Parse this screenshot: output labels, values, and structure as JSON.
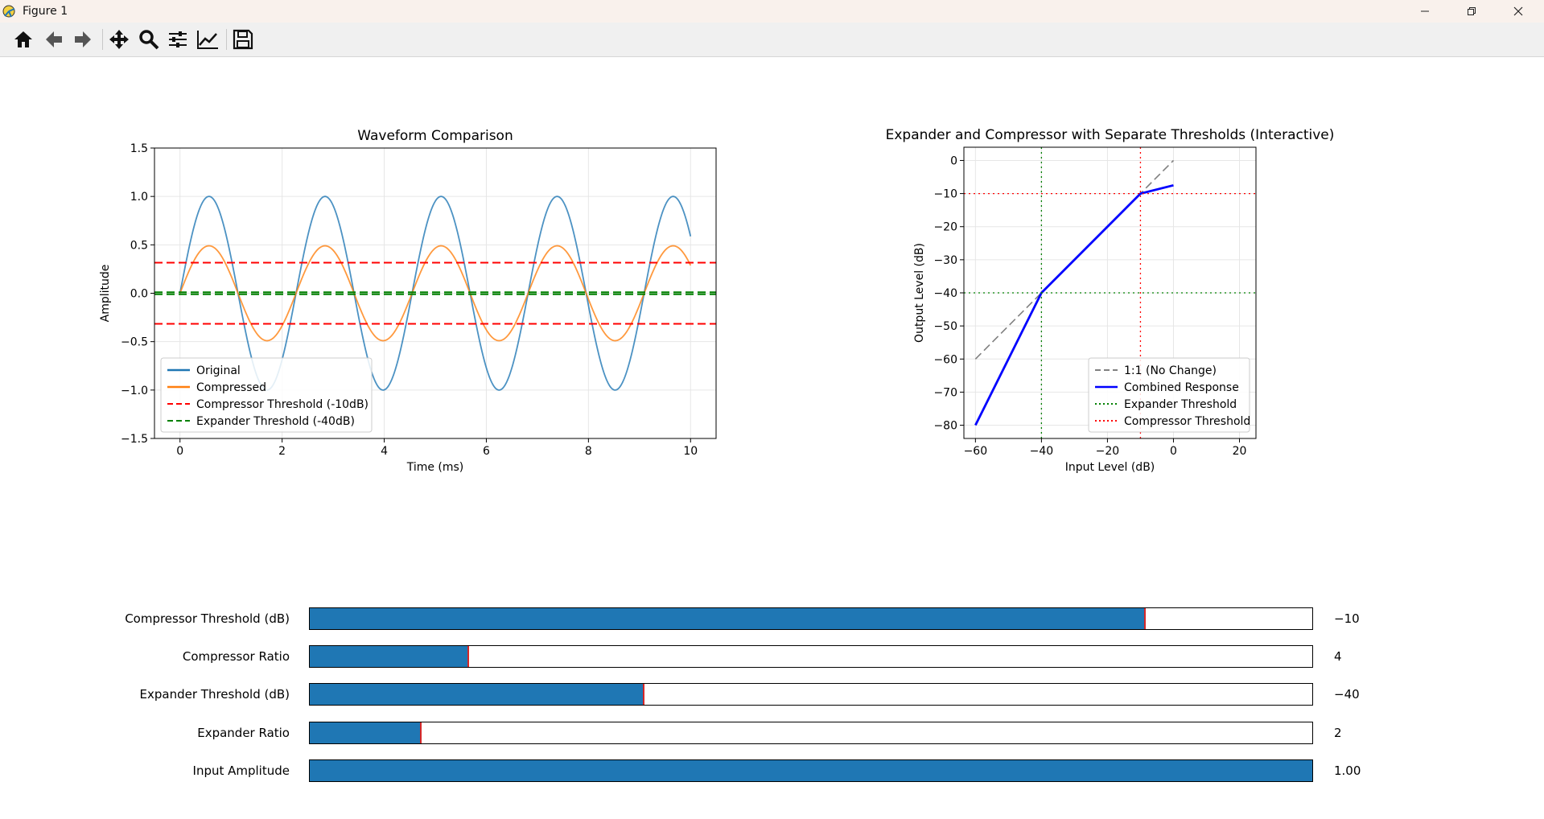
{
  "window": {
    "title": "Figure 1"
  },
  "toolbar": {
    "buttons": [
      {
        "name": "home-button",
        "icon": "home-icon"
      },
      {
        "name": "back-button",
        "icon": "arrow-left-icon"
      },
      {
        "name": "forward-button",
        "icon": "arrow-right-icon"
      },
      {
        "name": "pan-button",
        "icon": "move-icon"
      },
      {
        "name": "zoom-button",
        "icon": "magnifier-icon"
      },
      {
        "name": "configure-subplots-button",
        "icon": "sliders-icon"
      },
      {
        "name": "edit-axes-button",
        "icon": "line-chart-icon"
      },
      {
        "name": "save-button",
        "icon": "floppy-disk-icon"
      }
    ]
  },
  "chart_data": [
    {
      "type": "line",
      "title": "Waveform Comparison",
      "xlabel": "Time (ms)",
      "ylabel": "Amplitude",
      "xlim": [
        -0.5,
        10.5
      ],
      "ylim": [
        -1.5,
        1.5
      ],
      "xticks": [
        0,
        2,
        4,
        6,
        8,
        10
      ],
      "yticks": [
        -1.5,
        -1.0,
        -0.5,
        0.0,
        0.5,
        1.0,
        1.5
      ],
      "xtick_labels": [
        "0",
        "2",
        "4",
        "6",
        "8",
        "10"
      ],
      "ytick_labels": [
        "−1.5",
        "−1.0",
        "−0.5",
        "0.0",
        "0.5",
        "1.0",
        "1.5"
      ],
      "grid": true,
      "legend": "lower-left",
      "series": [
        {
          "name": "Original",
          "color": "#1f77b4",
          "function": "sine",
          "amplitude": 1.0,
          "frequency_khz": 0.44,
          "x_range": [
            0,
            10
          ]
        },
        {
          "name": "Compressed",
          "color": "#ff7f0e",
          "function": "sine",
          "amplitude": 0.49,
          "frequency_khz": 0.44,
          "x_range": [
            0,
            10
          ]
        },
        {
          "name": "Compressor Threshold (-10dB)",
          "color": "#ff0000",
          "style": "dashed",
          "hlines": [
            0.316,
            -0.316
          ]
        },
        {
          "name": "Expander Threshold (-40dB)",
          "color": "#008000",
          "style": "dashed",
          "hlines": [
            0.01,
            -0.01
          ]
        }
      ]
    },
    {
      "type": "line",
      "title": "Expander and Compressor with Separate Thresholds (Interactive)",
      "xlabel": "Input Level (dB)",
      "ylabel": "Output Level (dB)",
      "xlim": [
        -63.5,
        25
      ],
      "ylim": [
        -84,
        4
      ],
      "xticks": [
        -60,
        -40,
        -20,
        0,
        20
      ],
      "yticks": [
        -80,
        -70,
        -60,
        -50,
        -40,
        -30,
        -20,
        -10,
        0
      ],
      "xtick_labels": [
        "−60",
        "−40",
        "−20",
        "0",
        "20"
      ],
      "ytick_labels": [
        "−80",
        "−70",
        "−60",
        "−50",
        "−40",
        "−30",
        "−20",
        "−10",
        "0"
      ],
      "grid": true,
      "legend": "lower-right",
      "series": [
        {
          "name": "1:1 (No Change)",
          "color": "#808080",
          "style": "dashed",
          "x": [
            -60,
            0
          ],
          "y": [
            -60,
            0
          ]
        },
        {
          "name": "Combined Response",
          "color": "#0000ff",
          "style": "solid",
          "x": [
            -60,
            -40,
            -10,
            0
          ],
          "y": [
            -80,
            -40,
            -10,
            -7.5
          ]
        },
        {
          "name": "Expander Threshold",
          "color": "#008000",
          "style": "dotted",
          "vline": -40,
          "hline": -40
        },
        {
          "name": "Compressor Threshold",
          "color": "#ff0000",
          "style": "dotted",
          "vline": -10,
          "hline": -10
        }
      ]
    }
  ],
  "sliders": [
    {
      "name": "compressor-threshold-slider",
      "label": "Compressor Threshold (dB)",
      "value": "−10",
      "fill": 0.833,
      "marker": true
    },
    {
      "name": "compressor-ratio-slider",
      "label": "Compressor Ratio",
      "value": "4",
      "fill": 0.158,
      "marker": true
    },
    {
      "name": "expander-threshold-slider",
      "label": "Expander Threshold (dB)",
      "value": "−40",
      "fill": 0.333,
      "marker": true
    },
    {
      "name": "expander-ratio-slider",
      "label": "Expander Ratio",
      "value": "2",
      "fill": 0.111,
      "marker": true
    },
    {
      "name": "input-amplitude-slider",
      "label": "Input Amplitude",
      "value": "1.00",
      "fill": 1.0,
      "marker": false
    }
  ]
}
